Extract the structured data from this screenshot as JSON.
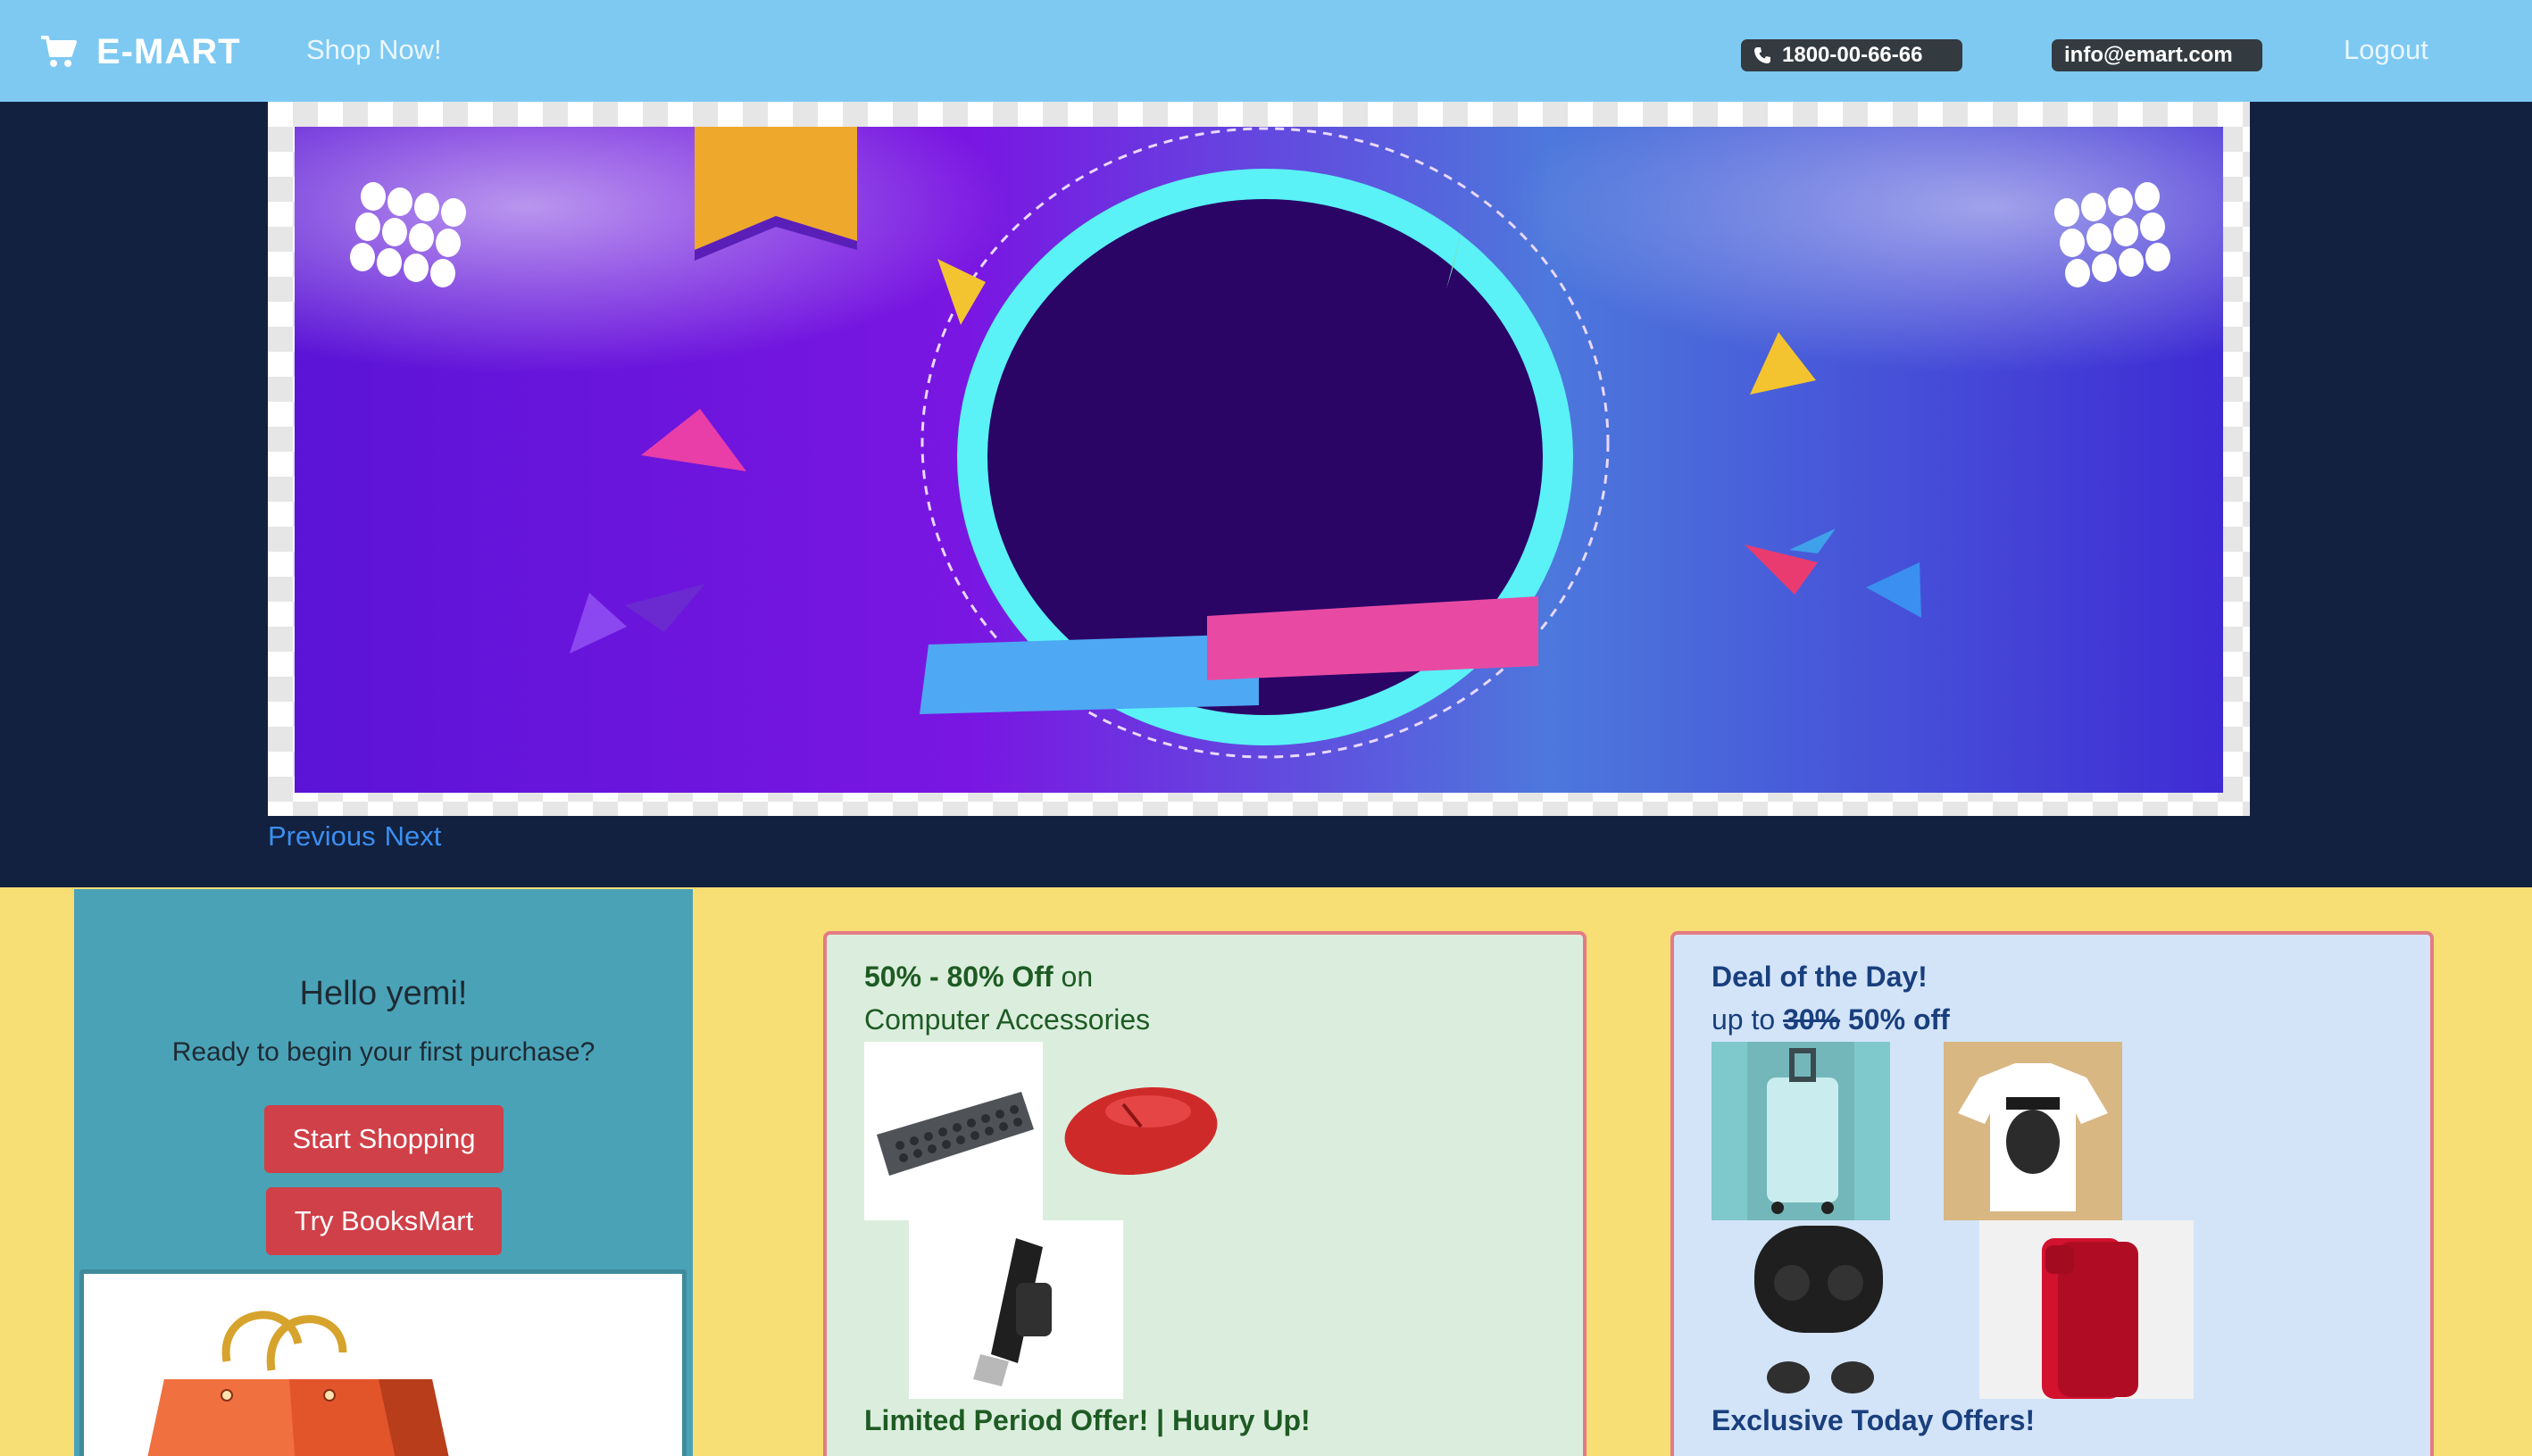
{
  "nav": {
    "brand": "E-MART",
    "shop_now": "Shop Now!",
    "phone": "1800-00-66-66",
    "email": "info@emart.com",
    "logout": "Logout"
  },
  "carousel": {
    "previous": "Previous",
    "next": "Next"
  },
  "welcome": {
    "title": "Hello yemi!",
    "subtitle": "Ready to begin your first purchase?",
    "start_btn": "Start Shopping",
    "books_btn": "Try BooksMart"
  },
  "offer_accessories": {
    "discount": "50% - 80% Off",
    "on": "on",
    "category": "Computer Accessories",
    "footer": "Limited Period Offer! | Huury Up!"
  },
  "offer_deal": {
    "title": "Deal of the Day!",
    "upto": "up to",
    "old_discount": "30%",
    "new_discount": "50% off",
    "footer": "Exclusive Today Offers!"
  },
  "colors": {
    "navbar": "#7dc9f2",
    "hero_bg": "#12213f",
    "page_bg": "#f7de75",
    "welcome_bg": "#4aa2b7",
    "button_red": "#d04048",
    "green_card": "#dbeedd",
    "blue_card": "#d3e4f9",
    "card_border": "#e37b84",
    "link": "#3b8ef0"
  },
  "icons": {
    "brand": "cart-icon",
    "phone": "phone-icon"
  }
}
